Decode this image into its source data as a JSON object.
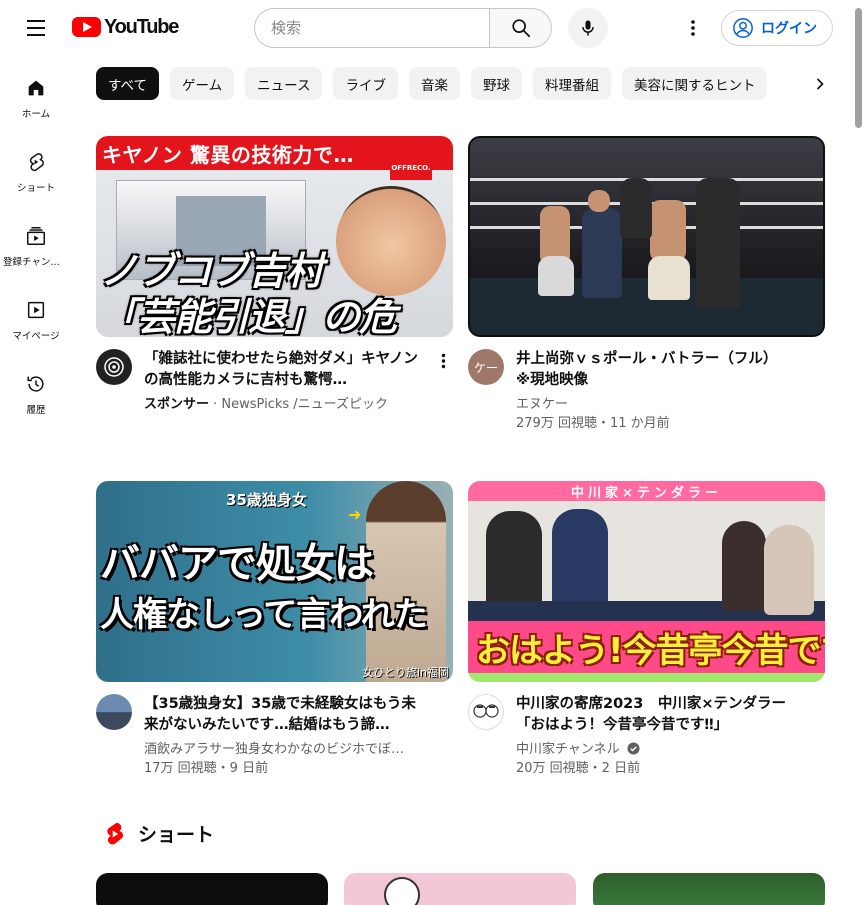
{
  "header": {
    "logo_text": "YouTube",
    "search_placeholder": "検索",
    "login_label": "ログイン"
  },
  "sidebar": {
    "items": [
      {
        "label": "ホーム",
        "icon": "home-icon"
      },
      {
        "label": "ショート",
        "icon": "shorts-icon"
      },
      {
        "label": "登録チャンネル",
        "icon": "subscriptions-icon"
      },
      {
        "label": "マイページ",
        "icon": "library-icon"
      },
      {
        "label": "履歴",
        "icon": "history-icon"
      }
    ]
  },
  "chips": [
    "すべて",
    "ゲーム",
    "ニュース",
    "ライブ",
    "音楽",
    "野球",
    "料理番組",
    "美容に関するヒント"
  ],
  "videos": [
    {
      "title": "「雑誌社に使わせたら絶対ダメ」キヤノンの高性能カメラに吉村も驚愕…",
      "sponsor": "スポンサー",
      "channel": "NewsPicks /ニューズピック",
      "stats": "",
      "thumb_text": {
        "banner": "キヤノン 驚異の技術力で…",
        "line1": "ノブコブ吉村",
        "line2": "「芸能引退」の危機？",
        "badge": "OFFRECO."
      }
    },
    {
      "title": "井上尚弥ｖｓポール・バトラー（フル）　※現地映像",
      "channel": "エヌケー",
      "stats": "279万 回視聴・11 か月前",
      "avatar_text": "ケー"
    },
    {
      "title": "【35歳独身女】35歳で未経験女はもう未来がないみたいです…結婚はもう諦…",
      "channel": "酒飲みアラサー独身女わかなのビジホでぼ…",
      "stats": "17万 回視聴・9 日前",
      "thumb_text": {
        "tag": "35歳独身女",
        "line1": "ババアで処女は",
        "line2": "人権なしって言われた",
        "footer": "女ひとり旅in福岡"
      }
    },
    {
      "title": "中川家の寄席2023　中川家×テンダラー　「おはよう！今昔亭今昔です‼」",
      "channel": "中川家チャンネル",
      "verified": true,
      "stats": "20万 回視聴・2 日前",
      "thumb_text": {
        "top": "中川家×テンダラー",
        "bottom": "おはよう!今昔亭今昔です!!"
      }
    }
  ],
  "shorts": {
    "title": "ショート"
  },
  "colors": {
    "brand_red": "#ff0000",
    "link_blue": "#065fd4",
    "chip_bg": "#f2f2f2",
    "chip_active_bg": "#0f0f0f",
    "meta_gray": "#606060"
  }
}
